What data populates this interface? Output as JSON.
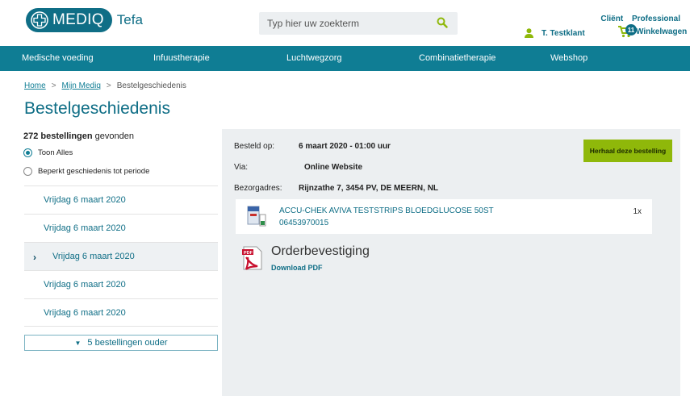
{
  "header": {
    "logo_text": "MEDIQ",
    "logo_sub": "Tefa",
    "search_placeholder": "Typ hier uw zoekterm",
    "user_name": "T. Testklant",
    "mode_client": "Cliënt",
    "mode_professional": "Professional",
    "cart_count": "11",
    "cart_label": "Winkelwagen"
  },
  "nav": {
    "items": [
      "Medische voeding",
      "Infuustherapie",
      "Luchtwegzorg",
      "Combinatietherapie",
      "Webshop"
    ]
  },
  "breadcrumb": {
    "home": "Home",
    "mijn": "Mijn Mediq",
    "current": "Bestelgeschiedenis"
  },
  "page_title": "Bestelgeschiedenis",
  "sidebar": {
    "count_number": "272 bestellingen",
    "count_suffix": " gevonden",
    "filter_all": "Toon Alles",
    "filter_period": "Beperkt geschiedenis tot periode",
    "orders": [
      "Vrijdag 6 maart 2020",
      "Vrijdag 6 maart 2020",
      "Vrijdag 6 maart 2020",
      "Vrijdag 6 maart 2020",
      "Vrijdag 6 maart 2020"
    ],
    "active_chevron": "›",
    "older_label": "5 bestellingen ouder"
  },
  "detail": {
    "ordered_label": "Besteld op:",
    "ordered_value": "6 maart 2020 - 01:00 uur",
    "via_label": "Via:",
    "via_value": "Online Website",
    "address_label": "Bezorgadres:",
    "address_value": "Rijnzathe 7, 3454 PV, DE MEERN, NL",
    "repeat_button": "Herhaal deze bestelling",
    "product": {
      "name": "ACCU-CHEK AVIVA TESTSTRIPS BLOEDGLUCOSE 50ST",
      "code": "06453970015",
      "qty": "1x"
    },
    "confirmation_title": "Orderbevestiging",
    "confirmation_link": "Download PDF"
  },
  "colors": {
    "brand": "#0f6e86",
    "nav": "#0f7d94",
    "accent_green": "#8fb80a",
    "panel": "#eceff1"
  },
  "icons": [
    "medical-cross-icon",
    "search-icon",
    "user-icon",
    "cart-icon",
    "chevron-right-icon",
    "caret-down-icon",
    "pdf-icon",
    "product-image"
  ]
}
